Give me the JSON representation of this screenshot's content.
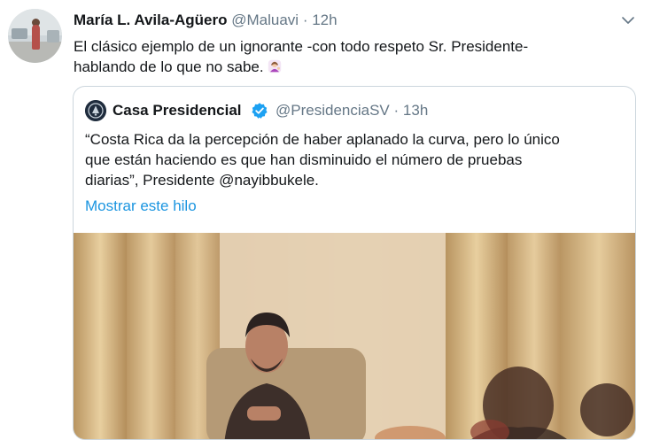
{
  "tweet": {
    "author_name": "María L. Avila-Agüero",
    "author_handle": "@Maluavi",
    "separator": "·",
    "time": "12h",
    "text_line1": "El clásico ejemplo de un ignorante -con todo respeto Sr. Presidente-",
    "text_line2": "hablando de lo que no sabe."
  },
  "quoted": {
    "author_name": "Casa Presidencial",
    "author_handle": "@PresidenciaSV",
    "separator": "·",
    "time": "13h",
    "text_line1": "“Costa Rica da la percepción de haber aplanado la curva, pero lo único",
    "text_line2": "que están haciendo es que han disminuido el número de pruebas",
    "text_line3": "diarias”, Presidente @nayibbukele.",
    "show_thread": "Mostrar este hilo"
  },
  "colors": {
    "link": "#1b95e0",
    "verified": "#1da1f2",
    "secondary_text": "#657786",
    "border": "#ccd6dd"
  },
  "icons": [
    "chevron-down-icon",
    "verified-badge-icon",
    "woman-tipping-hand-emoji"
  ]
}
